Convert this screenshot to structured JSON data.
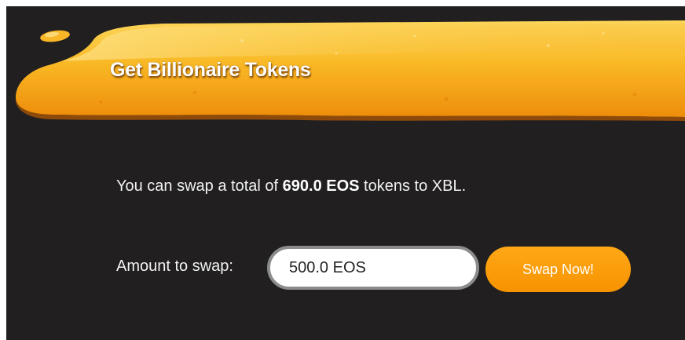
{
  "banner": {
    "title": "Get Billionaire Tokens"
  },
  "summary": {
    "prefix": "You can swap a total of ",
    "amount": "690.0 EOS",
    "suffix": " tokens to XBL."
  },
  "swap_form": {
    "label": "Amount to swap:",
    "input_value": "500.0 EOS",
    "button_label": "Swap Now!"
  },
  "colors": {
    "background": "#211f1f",
    "accent": "#f79300",
    "banner": "#f9b21c"
  }
}
